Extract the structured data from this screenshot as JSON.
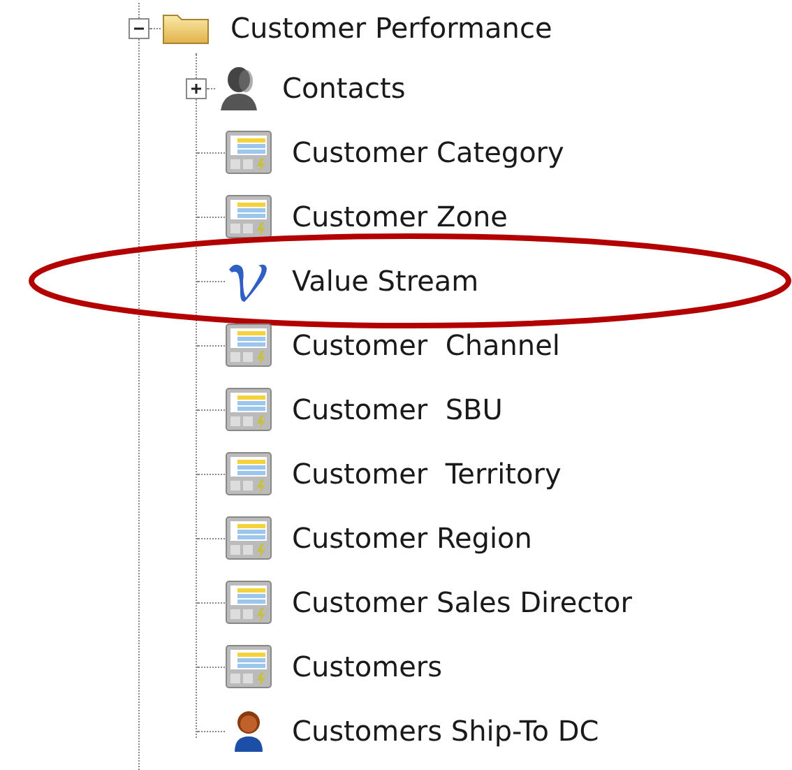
{
  "tree": {
    "label": "Customer Performance",
    "kind": "folder",
    "expanded": true,
    "children": [
      {
        "label": "Contacts",
        "kind": "contacts",
        "expanded": false,
        "highlighted": false
      },
      {
        "label": "Customer Category",
        "kind": "table",
        "highlighted": false
      },
      {
        "label": "Customer Zone",
        "kind": "table",
        "highlighted": false
      },
      {
        "label": "Value Stream",
        "kind": "value",
        "highlighted": true
      },
      {
        "label": "Customer  Channel",
        "kind": "table",
        "highlighted": false
      },
      {
        "label": "Customer  SBU",
        "kind": "table",
        "highlighted": false
      },
      {
        "label": "Customer  Territory",
        "kind": "table",
        "highlighted": false
      },
      {
        "label": "Customer Region",
        "kind": "table",
        "highlighted": false
      },
      {
        "label": "Customer Sales Director",
        "kind": "table",
        "highlighted": false
      },
      {
        "label": "Customers",
        "kind": "table",
        "highlighted": false
      },
      {
        "label": "Customers Ship-To DC",
        "kind": "person",
        "highlighted": false
      }
    ]
  }
}
